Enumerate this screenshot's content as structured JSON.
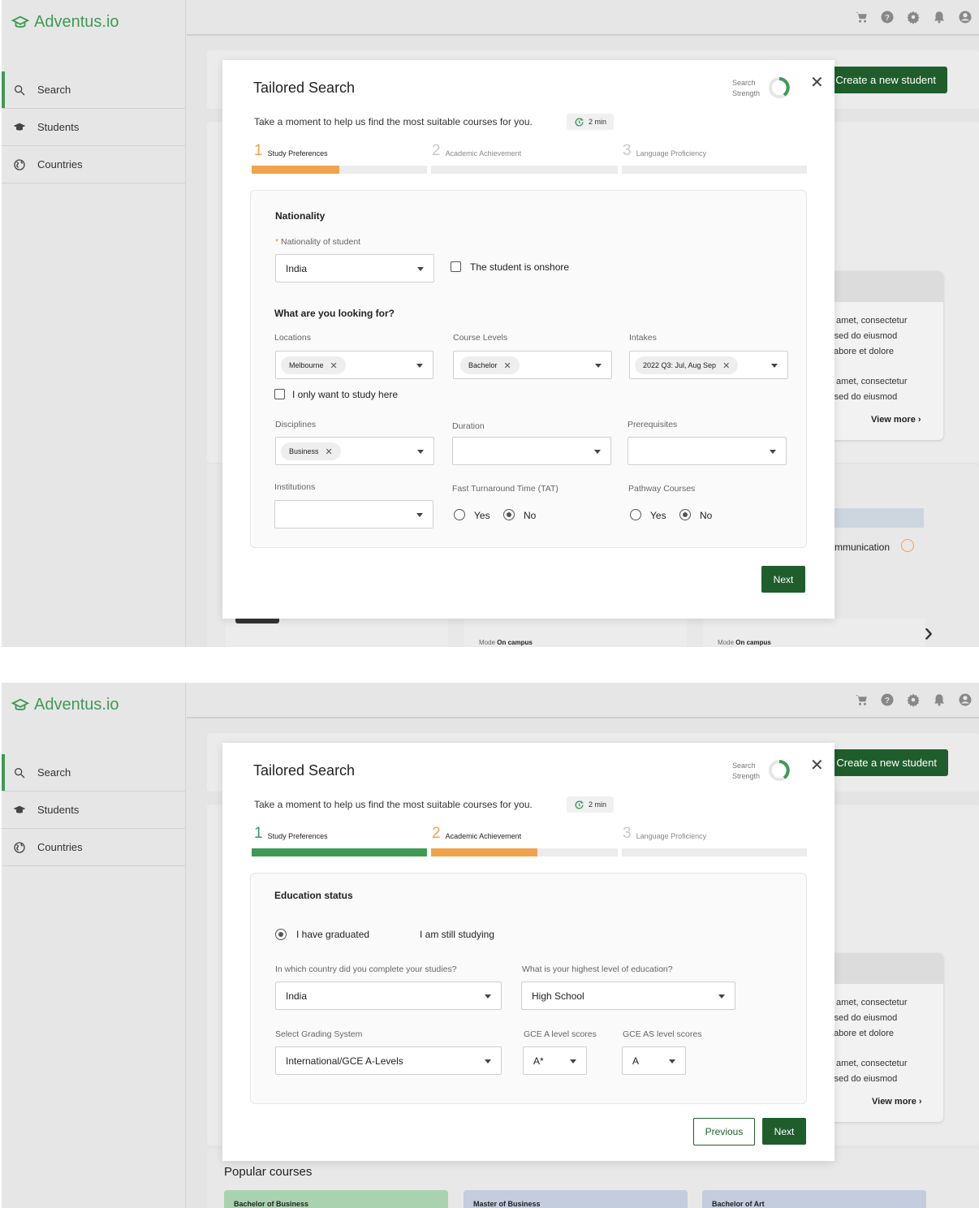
{
  "app": {
    "logo_text": "Adventus.io",
    "brand_color": "#3f9a55",
    "accent_color": "#f0a34b",
    "primary_button_color": "#1f5e2c"
  },
  "sidebar": {
    "items": [
      {
        "label": "Search",
        "icon": "search-icon",
        "active": true
      },
      {
        "label": "Students",
        "icon": "graduation-cap-icon",
        "active": false
      },
      {
        "label": "Countries",
        "icon": "globe-icon",
        "active": false
      }
    ]
  },
  "topbar": {
    "icons": [
      "cart-icon",
      "help-icon",
      "gear-icon",
      "bell-icon",
      "account-icon"
    ]
  },
  "background": {
    "create_button": "Create a new student",
    "card_lines": [
      "sit amet, consectetur",
      "it, sed do eiusmod",
      "it labore et dolore",
      "sit amet, consectetur",
      "it, sed do eiusmod"
    ],
    "view_more": "View more",
    "communication": "mmunication",
    "mode_label": "Mode",
    "mode_value": "On campus",
    "popular_title": "Popular courses",
    "popular_items": [
      "Bachelor of Business",
      "Master of Business",
      "Bachelor of Art"
    ]
  },
  "modal": {
    "title": "Tailored Search",
    "strength_label_1": "Search",
    "strength_label_2": "Strength",
    "subtitle": "Take a moment to help us find the most suitable courses for you.",
    "time": "2 min",
    "steps": [
      {
        "num": "1",
        "label": "Study Preferences"
      },
      {
        "num": "2",
        "label": "Academic Achievement"
      },
      {
        "num": "3",
        "label": "Language Proficiency"
      }
    ]
  },
  "step1": {
    "nationality_title": "Nationality",
    "nationality_label": "Nationality of student",
    "nationality_value": "India",
    "onshore_label": "The student is onshore",
    "looking_title": "What are you looking for?",
    "locations_label": "Locations",
    "locations_chip": "Melbourne",
    "course_levels_label": "Course Levels",
    "course_levels_chip": "Bachelor",
    "intakes_label": "Intakes",
    "intakes_chip": "2022 Q3: Jul, Aug Sep",
    "only_study_label": "I only want to study here",
    "disciplines_label": "Disciplines",
    "disciplines_chip": "Business",
    "duration_label": "Duration",
    "prerequisites_label": "Prerequisites",
    "institutions_label": "Institutions",
    "tat_label": "Fast Turnaround Time (TAT)",
    "pathway_label": "Pathway Courses",
    "yes": "Yes",
    "no": "No",
    "next": "Next",
    "progress_step1": 0.5
  },
  "step2": {
    "education_title": "Education status",
    "graduated": "I have graduated",
    "studying": "I am still studying",
    "country_label": "In which country did you complete your studies?",
    "country_value": "India",
    "highest_label": "What is your highest level of education?",
    "highest_value": "High School",
    "grading_label": "Select Grading System",
    "grading_value": "International/GCE A-Levels",
    "gce_a_label": "GCE A level scores",
    "gce_a_value": "A*",
    "gce_as_label": "GCE AS level scores",
    "gce_as_value": "A",
    "previous": "Previous",
    "next": "Next",
    "progress_step2": 0.57
  }
}
